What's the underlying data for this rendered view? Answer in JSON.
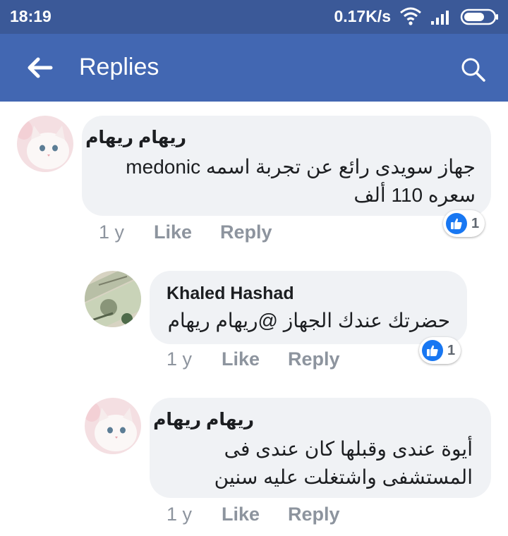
{
  "status_bar": {
    "time": "18:19",
    "network_speed": "0.17K/s",
    "icons": [
      "wifi-icon",
      "signal-icon",
      "battery-icon"
    ]
  },
  "app_bar": {
    "title": "Replies",
    "back_icon": "arrow-left-icon",
    "search_icon": "search-icon"
  },
  "colors": {
    "status_bar_bg": "#3b5998",
    "app_bar_bg": "#4267b2",
    "bubble_bg": "#f0f2f5",
    "meta_text": "#8d949e",
    "like_blue": "#1877f2"
  },
  "comments": [
    {
      "author": "ريهام ريهام",
      "text_lines": [
        "جهاز سويدى رائع عن تجربة اسمه medonic",
        "سعره 110 ألف"
      ],
      "time": "1 y",
      "like_label": "Like",
      "reply_label": "Reply",
      "reaction_count": "1",
      "avatar": "kitten-avatar"
    },
    {
      "author": "Khaled Hashad",
      "text_lines": [
        "حضرتك عندك الجهاز @ريهام ريهام"
      ],
      "time": "1 y",
      "like_label": "Like",
      "reply_label": "Reply",
      "reaction_count": "1",
      "avatar": "banknote-avatar"
    },
    {
      "author": "ريهام ريهام",
      "text_lines": [
        "أيوة عندى وقبلها كان عندى فى",
        "المستشفى واشتغلت عليه سنين"
      ],
      "time": "1 y",
      "like_label": "Like",
      "reply_label": "Reply",
      "avatar": "kitten-avatar"
    }
  ]
}
